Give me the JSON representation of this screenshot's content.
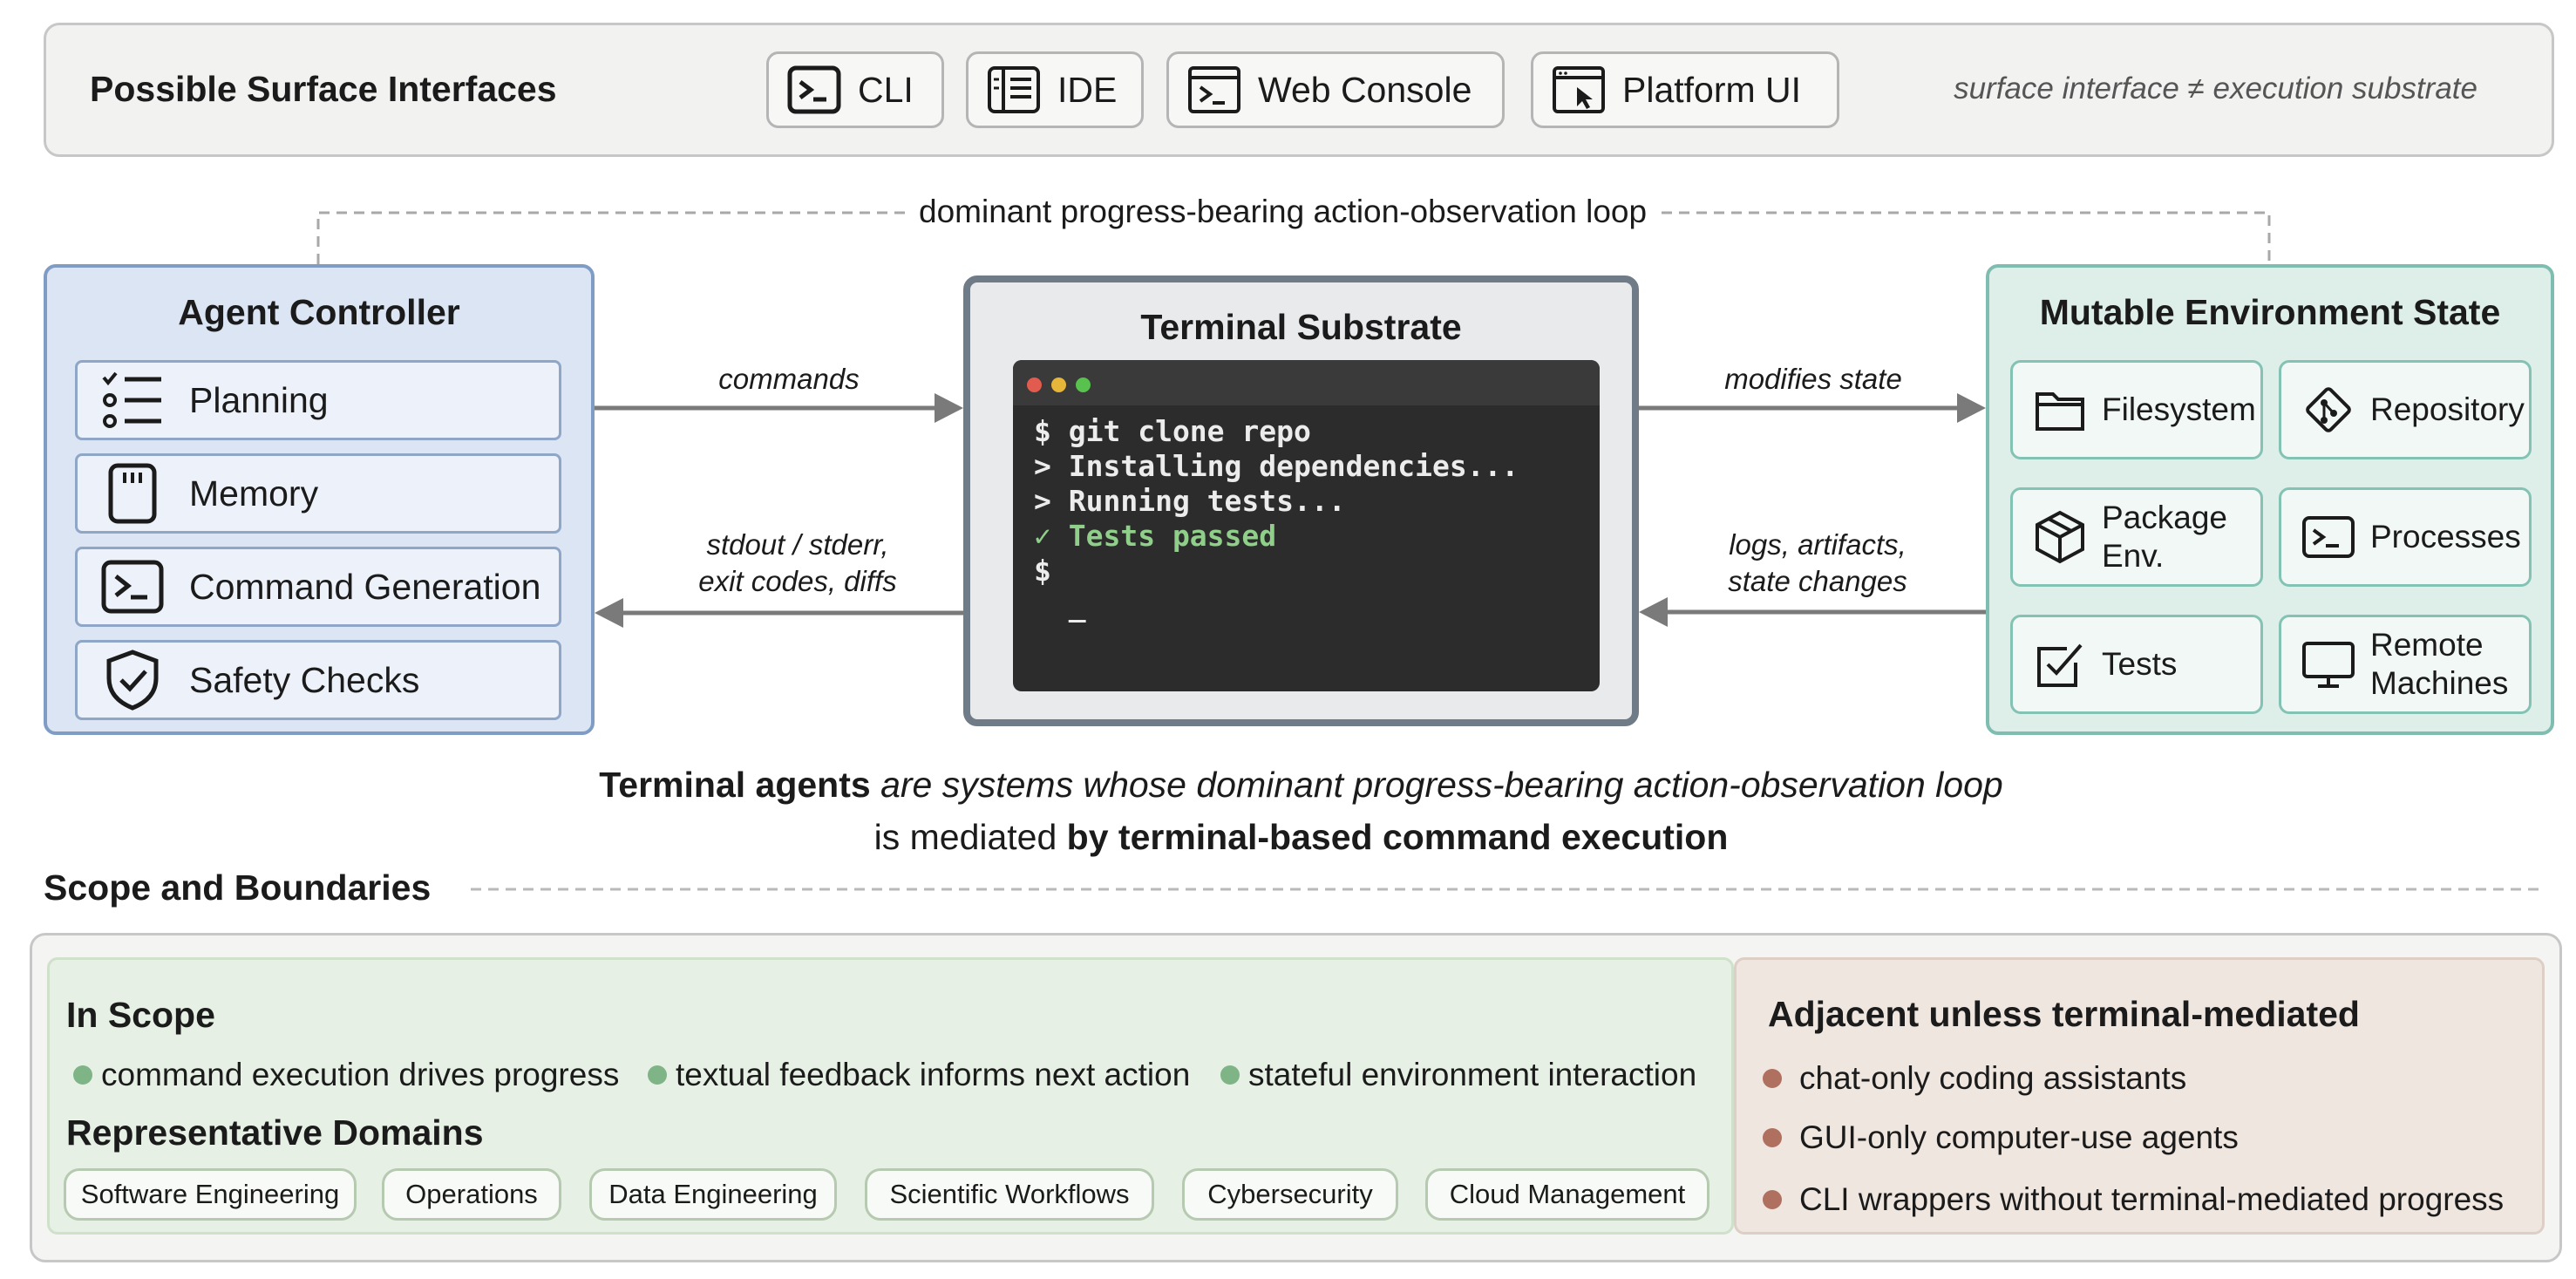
{
  "surface": {
    "title": "Possible Surface Interfaces",
    "interfaces": [
      {
        "label": "CLI",
        "icon": "terminal-prompt-icon"
      },
      {
        "label": "IDE",
        "icon": "code-editor-icon"
      },
      {
        "label": "Web Console",
        "icon": "browser-terminal-icon"
      },
      {
        "label": "Platform UI",
        "icon": "window-cursor-icon"
      }
    ],
    "note": "surface interface ≠ execution substrate"
  },
  "loop_label": "dominant progress-bearing action-observation loop",
  "agent": {
    "title": "Agent Controller",
    "items": [
      {
        "label": "Planning",
        "icon": "checklist-icon"
      },
      {
        "label": "Memory",
        "icon": "memory-card-icon"
      },
      {
        "label": "Command Generation",
        "icon": "terminal-prompt-icon"
      },
      {
        "label": "Safety Checks",
        "icon": "shield-check-icon"
      }
    ],
    "color": "#dbe5f4"
  },
  "terminal": {
    "title": "Terminal Substrate",
    "lines": [
      {
        "text": "$ git clone repo",
        "ok": false
      },
      {
        "text": "> Installing dependencies...",
        "ok": false
      },
      {
        "text": "> Running tests...",
        "ok": false
      },
      {
        "text": "✓ Tests passed",
        "ok": true
      },
      {
        "text": "$",
        "ok": false
      },
      {
        "text": "  _",
        "ok": false
      }
    ]
  },
  "environment": {
    "title": "Mutable Environment State",
    "items": [
      {
        "label": "Filesystem",
        "icon": "folder-icon"
      },
      {
        "label": "Repository",
        "icon": "git-icon"
      },
      {
        "label": "Package\nEnv.",
        "icon": "package-icon"
      },
      {
        "label": "Processes",
        "icon": "terminal-prompt-icon"
      },
      {
        "label": "Tests",
        "icon": "checkbox-icon"
      },
      {
        "label": "Remote\nMachines",
        "icon": "monitor-icon"
      }
    ],
    "color": "#deefea"
  },
  "edges": {
    "commands": "commands",
    "feedback_line1": "stdout / stderr,",
    "feedback_line2": "exit codes, diffs",
    "modifies": "modifies state",
    "env_feedback_line1": "logs, artifacts,",
    "env_feedback_line2": "state changes"
  },
  "definition": {
    "bold1": "Terminal agents",
    "italic": " are systems whose dominant progress-bearing action-observation loop",
    "plain": "is mediated ",
    "bold2": "by terminal-based command execution"
  },
  "scope": {
    "title": "Scope and Boundaries",
    "in_scope_title": "In Scope",
    "in_scope_items": [
      "command execution drives progress",
      "textual feedback informs next action",
      "stateful environment interaction"
    ],
    "domains_title": "Representative Domains",
    "domains": [
      "Software Engineering",
      "Operations",
      "Data Engineering",
      "Scientific Workflows",
      "Cybersecurity",
      "Cloud Management"
    ],
    "adjacent_title": "Adjacent unless terminal-mediated",
    "adjacent_items": [
      "chat-only coding assistants",
      "GUI-only computer-use agents",
      "CLI wrappers without terminal-mediated progress"
    ],
    "in_scope_bullet_color": "#7fb487",
    "adjacent_bullet_color": "#b07060"
  }
}
